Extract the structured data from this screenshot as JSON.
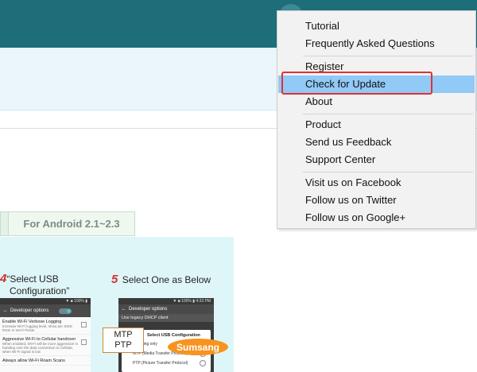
{
  "background_page": {
    "android_tab_label": "For Android 2.1~2.3",
    "step4": {
      "number": "4",
      "line1": "“Select USB",
      "line2": "Configuration”"
    },
    "step5": {
      "number": "5",
      "text": "Select One as Below"
    },
    "phone1": {
      "status": "▼ ■ 100% ▮",
      "header": "Developer options",
      "toggle": "ON",
      "rows": [
        {
          "title": "Enable Wi-Fi Verbose Logging",
          "desc": "Increase Wi-Fi logging level, show per SSID RSSI in Wi-Fi Picker"
        },
        {
          "title": "Aggressive Wi-Fi to Cellular handover",
          "desc": "When enabled, Wi-Fi will be more aggressive in handing over the data connection to Cellular, when Wi-Fi signal is low"
        },
        {
          "title": "Always allow Wi-Fi Roam Scans",
          "desc": ""
        }
      ]
    },
    "phone2": {
      "status": "▼ ■ 100% ▮ 4:33 PM",
      "header": "Developer options",
      "dim_row": "Use legacy DHCP client",
      "dialog_title": "Select USB Configuration",
      "options": [
        "Charging only",
        "MTP (Media Transfer Protocol)",
        "PTP (Picture Transfer Protocol)"
      ]
    },
    "callout_mtp": {
      "line1": "MTP",
      "line2": "PTP"
    },
    "callout_samsung": "Sumsang"
  },
  "context_menu": {
    "items": [
      "Tutorial",
      "Frequently Asked Questions",
      "Register",
      "Check for Update",
      "About",
      "Product",
      "Send us Feedback",
      "Support Center",
      "Visit us on Facebook",
      "Follow us on Twitter",
      "Follow us on Google+"
    ],
    "highlighted": "Check for Update"
  },
  "colors": {
    "topbar": "#1d6e78",
    "menu_bg": "#f2f2f2",
    "menu_highlight": "#91c9f7",
    "annotation_red": "#e03232",
    "samsung_orange": "#f7931e"
  }
}
